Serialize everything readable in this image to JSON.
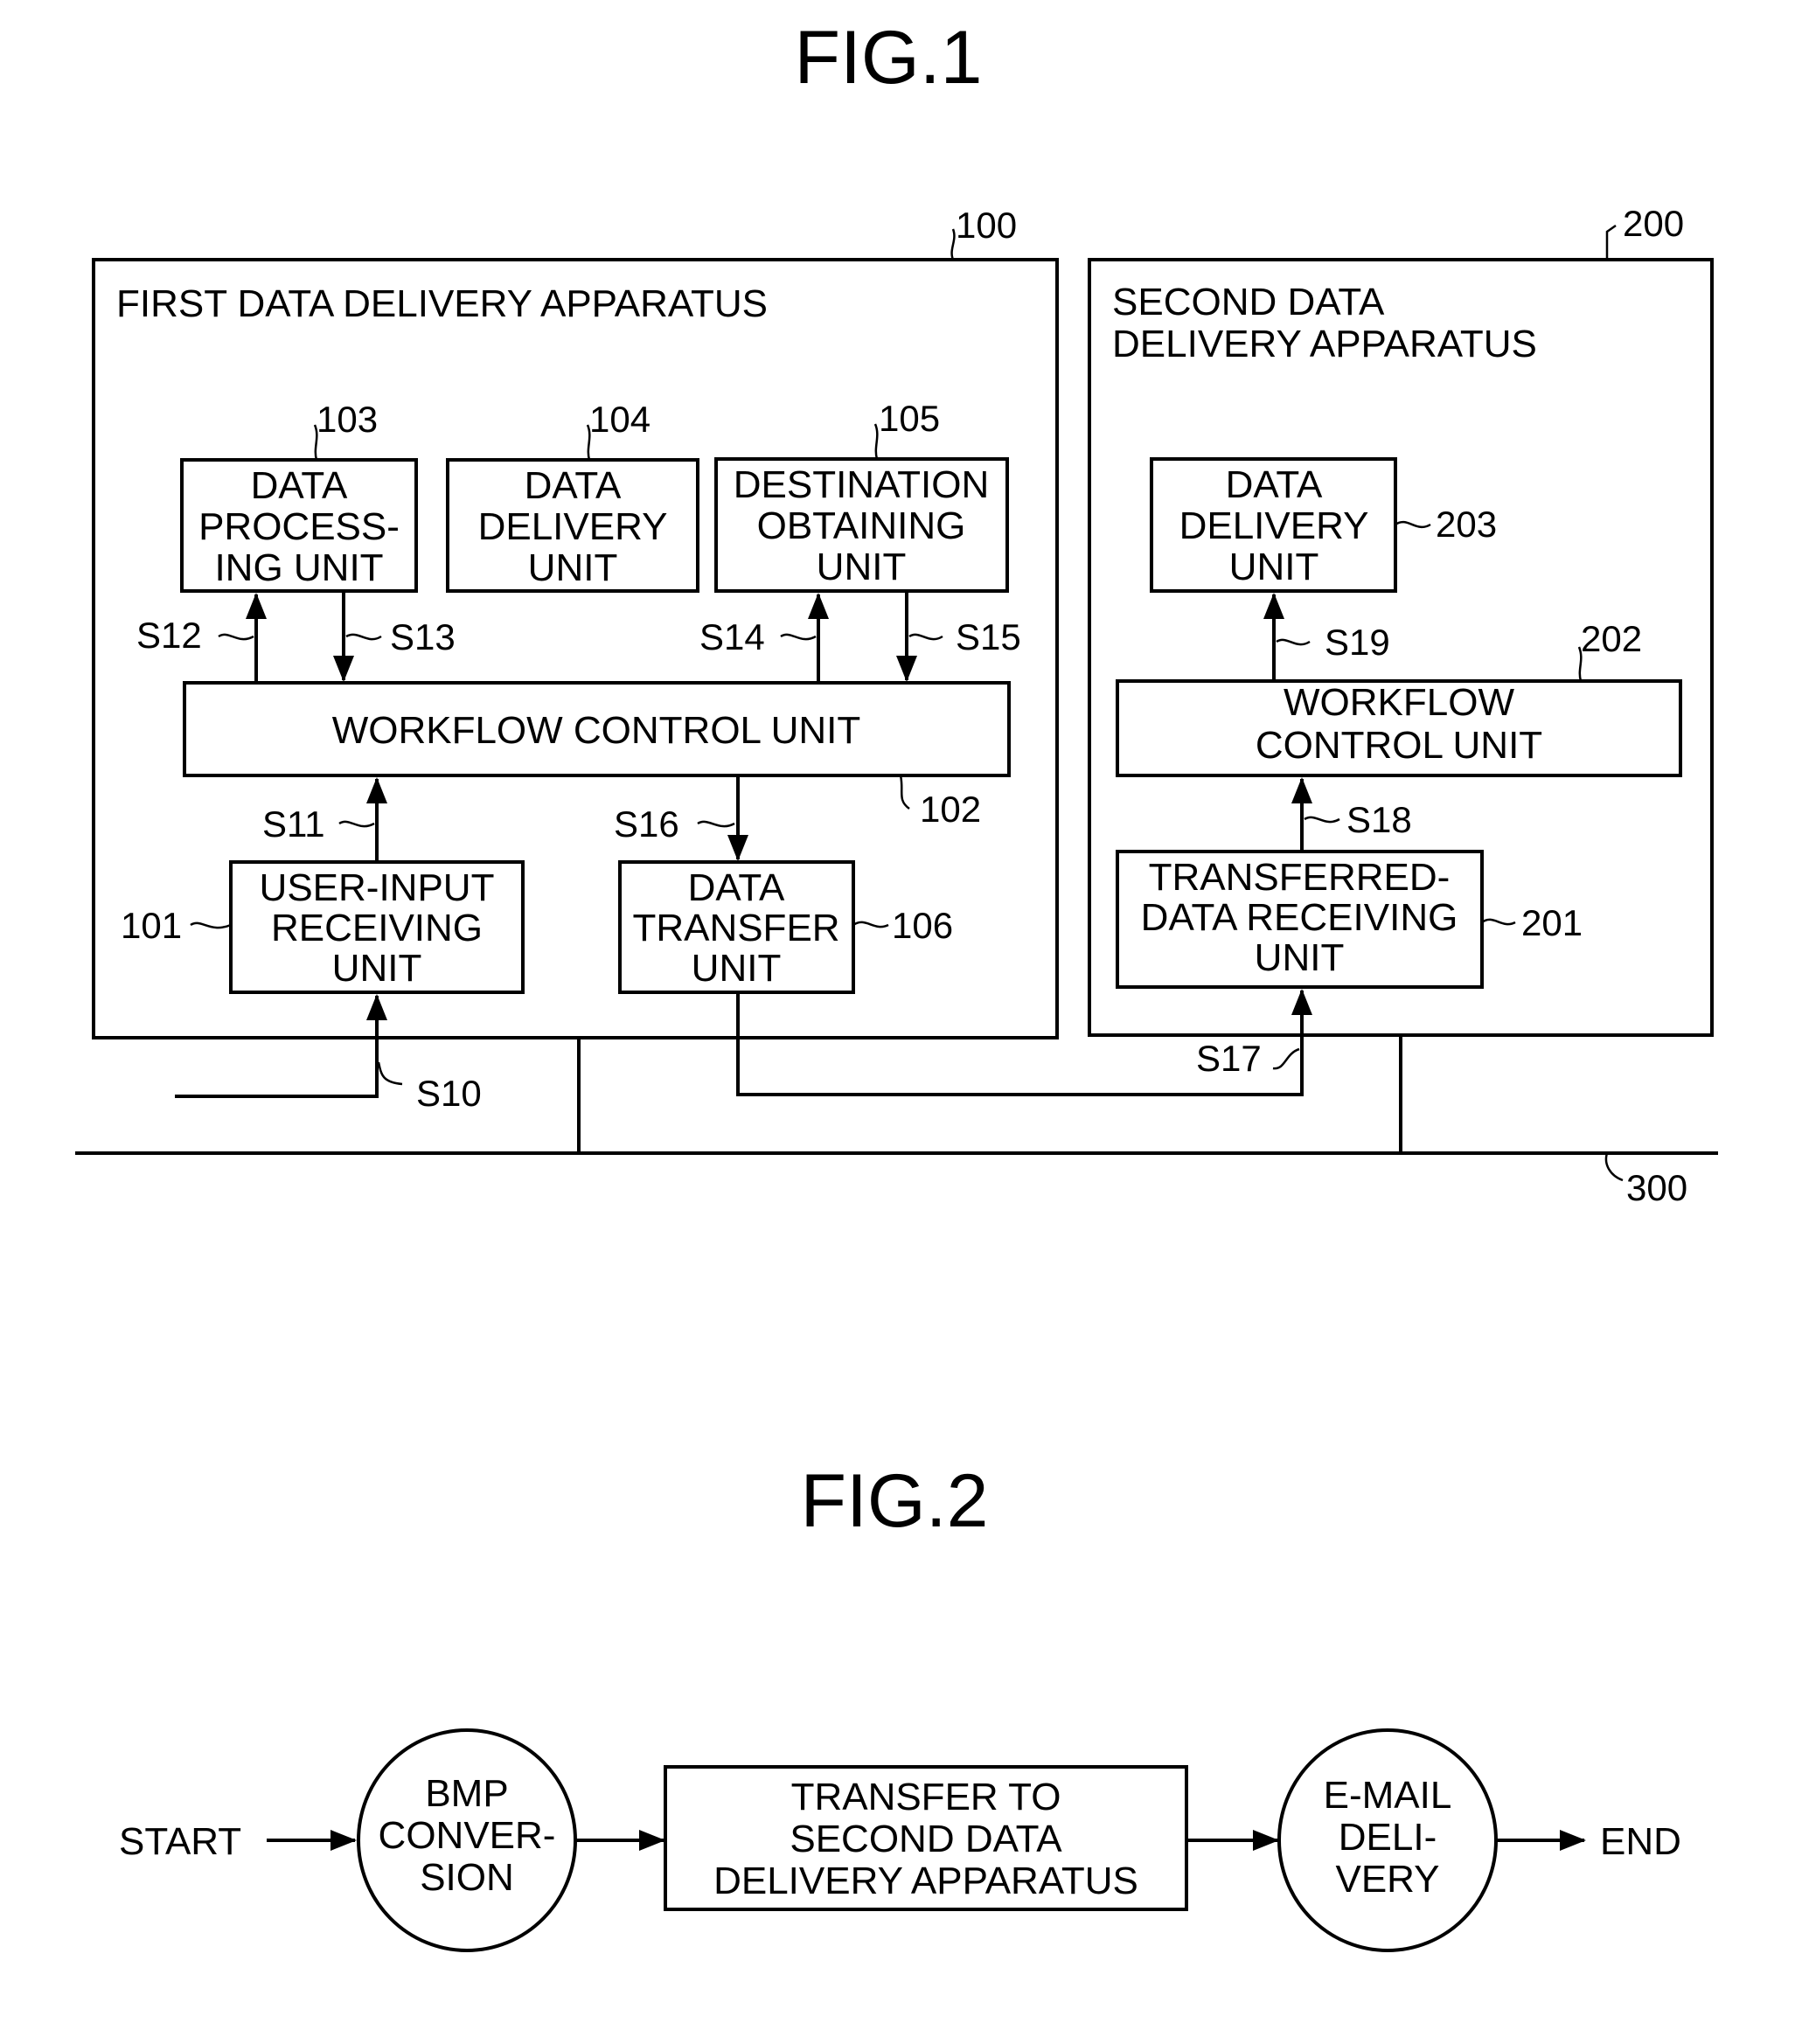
{
  "fig1": {
    "title": "FIG.1",
    "apparatus1": {
      "ref": "100",
      "title": "FIRST DATA DELIVERY APPARATUS",
      "units": {
        "u101": {
          "ref": "101",
          "lines": [
            "USER-INPUT",
            "RECEIVING",
            "UNIT"
          ]
        },
        "u102": {
          "ref": "102",
          "lines": [
            "WORKFLOW CONTROL UNIT"
          ]
        },
        "u103": {
          "ref": "103",
          "lines": [
            "DATA",
            "PROCESS-",
            "ING UNIT"
          ]
        },
        "u104": {
          "ref": "104",
          "lines": [
            "DATA",
            "DELIVERY",
            "UNIT"
          ]
        },
        "u105": {
          "ref": "105",
          "lines": [
            "DESTINATION",
            "OBTAINING",
            "UNIT"
          ]
        },
        "u106": {
          "ref": "106",
          "lines": [
            "DATA",
            "TRANSFER",
            "UNIT"
          ]
        }
      }
    },
    "apparatus2": {
      "ref": "200",
      "title_lines": [
        "SECOND DATA",
        "DELIVERY APPARATUS"
      ],
      "units": {
        "u201": {
          "ref": "201",
          "lines": [
            "TRANSFERRED-",
            "DATA RECEIVING",
            "UNIT"
          ]
        },
        "u202": {
          "ref": "202",
          "lines": [
            "WORKFLOW",
            "CONTROL UNIT"
          ]
        },
        "u203": {
          "ref": "203",
          "lines": [
            "DATA",
            "DELIVERY",
            "UNIT"
          ]
        }
      }
    },
    "network_ref": "300",
    "signals": {
      "s10": "S10",
      "s11": "S11",
      "s12": "S12",
      "s13": "S13",
      "s14": "S14",
      "s15": "S15",
      "s16": "S16",
      "s17": "S17",
      "s18": "S18",
      "s19": "S19"
    }
  },
  "fig2": {
    "title": "FIG.2",
    "start": "START",
    "end": "END",
    "steps": [
      {
        "shape": "circle",
        "lines": [
          "BMP",
          "CONVER-",
          "SION"
        ]
      },
      {
        "shape": "rect",
        "lines": [
          "TRANSFER TO",
          "SECOND DATA",
          "DELIVERY APPARATUS"
        ]
      },
      {
        "shape": "circle",
        "lines": [
          "E-MAIL",
          "DELI-",
          "VERY"
        ]
      }
    ]
  }
}
